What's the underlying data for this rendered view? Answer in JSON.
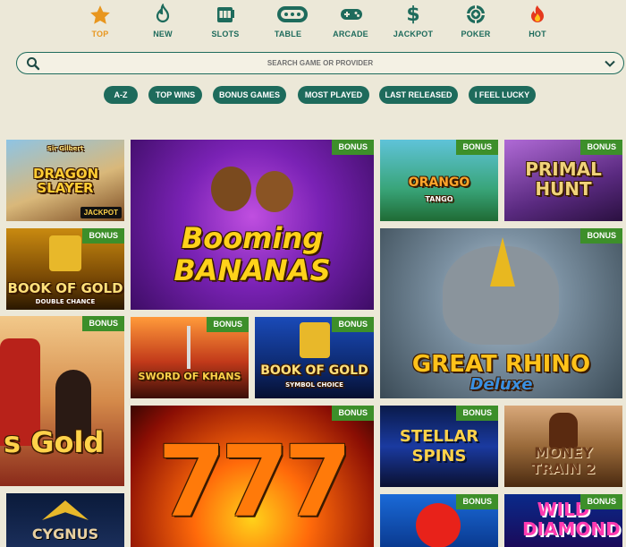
{
  "categories": [
    {
      "label": "TOP",
      "icon": "star-icon",
      "active": true
    },
    {
      "label": "NEW",
      "icon": "flame-icon",
      "active": false
    },
    {
      "label": "SLOTS",
      "icon": "slot-machine-icon",
      "active": false
    },
    {
      "label": "TABLE",
      "icon": "table-icon",
      "active": false
    },
    {
      "label": "ARCADE",
      "icon": "gamepad-icon",
      "active": false
    },
    {
      "label": "JACKPOT",
      "icon": "dollar-icon",
      "active": false
    },
    {
      "label": "POKER",
      "icon": "poker-chip-icon",
      "active": false
    },
    {
      "label": "HOT",
      "icon": "fire-icon",
      "active": false
    }
  ],
  "search": {
    "placeholder": "SEARCH GAME OR PROVIDER"
  },
  "filters": [
    "A-Z",
    "TOP WINS",
    "BONUS GAMES",
    "MOST PLAYED",
    "LAST RELEASED",
    "I FEEL LUCKY"
  ],
  "games": [
    {
      "title": "DRAGON SLAYER",
      "subtitle": "Sir Gilbert",
      "badge": "",
      "jackpot": "JACKPOT"
    },
    {
      "title": "Booming BANANAS",
      "subtitle": "",
      "badge": "BONUS",
      "jackpot": ""
    },
    {
      "title": "ORANGO",
      "subtitle": "TANGO",
      "badge": "BONUS",
      "jackpot": ""
    },
    {
      "title": "PRIMAL HUNT",
      "subtitle": "",
      "badge": "BONUS",
      "jackpot": ""
    },
    {
      "title": "BOOK OF GOLD",
      "subtitle": "DOUBLE CHANCE",
      "badge": "BONUS",
      "jackpot": ""
    },
    {
      "title": "GREAT RHINO",
      "subtitle": "Deluxe",
      "badge": "BONUS",
      "jackpot": ""
    },
    {
      "title": "s Gold",
      "subtitle": "",
      "badge": "BONUS",
      "jackpot": ""
    },
    {
      "title": "SWORD OF KHANS",
      "subtitle": "",
      "badge": "BONUS",
      "jackpot": ""
    },
    {
      "title": "BOOK OF GOLD",
      "subtitle": "SYMBOL CHOICE",
      "badge": "BONUS",
      "jackpot": ""
    },
    {
      "title": "777",
      "subtitle": "",
      "badge": "BONUS",
      "jackpot": ""
    },
    {
      "title": "STELLAR SPINS",
      "subtitle": "",
      "badge": "BONUS",
      "jackpot": ""
    },
    {
      "title": "MONEY TRAIN 2",
      "subtitle": "",
      "badge": "",
      "jackpot": ""
    },
    {
      "title": "CYGNUS",
      "subtitle": "",
      "badge": "",
      "jackpot": ""
    },
    {
      "title": "",
      "subtitle": "",
      "badge": "BONUS",
      "jackpot": ""
    },
    {
      "title": "WILD DIAMOND",
      "subtitle": "",
      "badge": "BONUS",
      "jackpot": ""
    }
  ],
  "colors": {
    "accent": "#1e6b5c",
    "active": "#e8961e",
    "badge": "#3d8f2a",
    "background": "#ece8d8"
  }
}
